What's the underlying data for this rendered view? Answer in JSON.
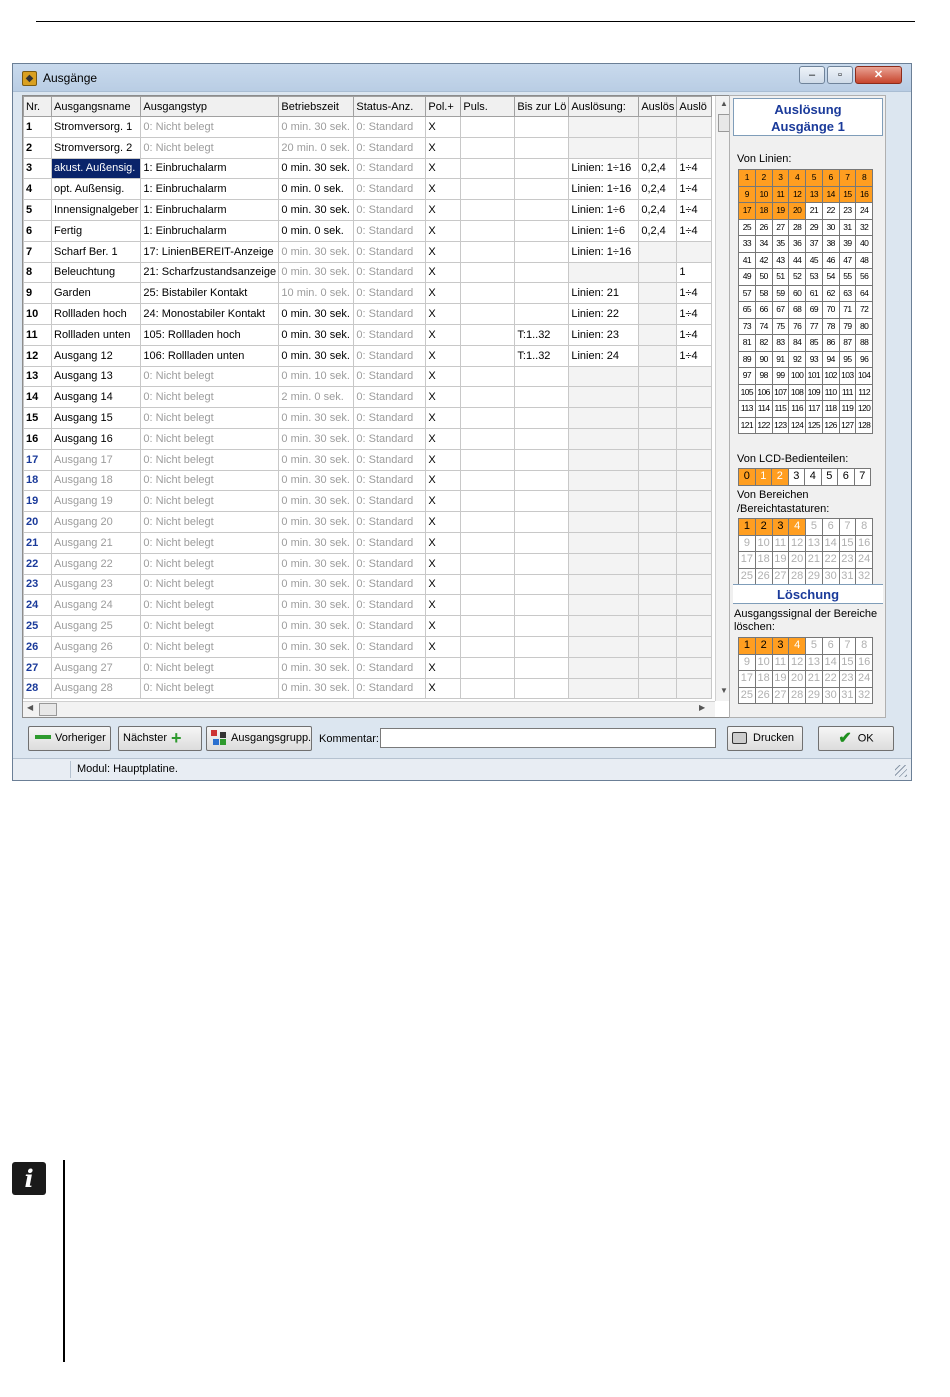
{
  "window": {
    "title": "Ausgänge"
  },
  "titlebar_buttons": {
    "minimize": "–",
    "maximize": "▫",
    "close": "✕"
  },
  "columns": [
    "Nr.",
    "Ausgangsname",
    "Ausgangstyp",
    "Betriebszeit",
    "Status-Anz.",
    "Pol.+",
    "Puls.",
    "Bis zur Lö",
    "Auslösung:",
    "Auslös",
    "Auslö"
  ],
  "rows": [
    {
      "nr": "1",
      "name": "Stromversorg. 1",
      "type": "0: Nicht belegt",
      "zeit": "0 min. 30 sek.",
      "status": "0: Standard",
      "pol": "X",
      "puls": "",
      "bis": "",
      "ausl": "",
      "ausl2": "",
      "ausl3": ""
    },
    {
      "nr": "2",
      "name": "Stromversorg. 2",
      "type": "0: Nicht belegt",
      "zeit": "20 min. 0 sek.",
      "status": "0: Standard",
      "pol": "X",
      "puls": "",
      "bis": "",
      "ausl": "",
      "ausl2": "",
      "ausl3": ""
    },
    {
      "nr": "3",
      "name": "akust. Außensig.",
      "type": "1: Einbruchalarm",
      "zeit": "0 min. 30 sek.",
      "status": "0: Standard",
      "pol": "X",
      "puls": "",
      "bis": "",
      "ausl": "Linien: 1÷16",
      "ausl2": "0,2,4",
      "ausl3": "1÷4"
    },
    {
      "nr": "4",
      "name": "opt. Außensig.",
      "type": "1: Einbruchalarm",
      "zeit": "0 min. 0 sek.",
      "status": "0: Standard",
      "pol": "X",
      "puls": "",
      "bis": "",
      "ausl": "Linien: 1÷16",
      "ausl2": "0,2,4",
      "ausl3": "1÷4"
    },
    {
      "nr": "5",
      "name": "Innensignalgeber",
      "type": "1: Einbruchalarm",
      "zeit": "0 min. 30 sek.",
      "status": "0: Standard",
      "pol": "X",
      "puls": "",
      "bis": "",
      "ausl": "Linien: 1÷6",
      "ausl2": "0,2,4",
      "ausl3": "1÷4"
    },
    {
      "nr": "6",
      "name": "Fertig",
      "type": "1: Einbruchalarm",
      "zeit": "0 min. 0 sek.",
      "status": "0: Standard",
      "pol": "X",
      "puls": "",
      "bis": "",
      "ausl": "Linien: 1÷6",
      "ausl2": "0,2,4",
      "ausl3": "1÷4"
    },
    {
      "nr": "7",
      "name": "Scharf Ber. 1",
      "type": "17: LinienBEREIT-Anzeige",
      "zeit": "0 min. 30 sek.",
      "status": "0: Standard",
      "pol": "X",
      "puls": "",
      "bis": "",
      "ausl": "Linien: 1÷16",
      "ausl2": "",
      "ausl3": ""
    },
    {
      "nr": "8",
      "name": "Beleuchtung",
      "type": "21: Scharfzustandsanzeige",
      "zeit": "0 min. 30 sek.",
      "status": "0: Standard",
      "pol": "X",
      "puls": "",
      "bis": "",
      "ausl": "",
      "ausl2": "",
      "ausl3": "1"
    },
    {
      "nr": "9",
      "name": "Garden",
      "type": "25: Bistabiler Kontakt",
      "zeit": "10 min. 0 sek.",
      "status": "0: Standard",
      "pol": "X",
      "puls": "",
      "bis": "",
      "ausl": "Linien: 21",
      "ausl2": "",
      "ausl3": "1÷4"
    },
    {
      "nr": "10",
      "name": "Rollladen hoch",
      "type": "24: Monostabiler Kontakt",
      "zeit": "0 min. 30 sek.",
      "status": "0: Standard",
      "pol": "X",
      "puls": "",
      "bis": "",
      "ausl": "Linien: 22",
      "ausl2": "",
      "ausl3": "1÷4"
    },
    {
      "nr": "11",
      "name": "Rollladen unten",
      "type": "105: Rollladen hoch",
      "zeit": "0 min. 30 sek.",
      "status": "0: Standard",
      "pol": "X",
      "puls": "",
      "bis": "T:1..32",
      "ausl": "Linien: 23",
      "ausl2": "",
      "ausl3": "1÷4"
    },
    {
      "nr": "12",
      "name": "Ausgang 12",
      "type": "106: Rollladen unten",
      "zeit": "0 min. 30 sek.",
      "status": "0: Standard",
      "pol": "X",
      "puls": "",
      "bis": "T:1..32",
      "ausl": "Linien: 24",
      "ausl2": "",
      "ausl3": "1÷4"
    },
    {
      "nr": "13",
      "name": "Ausgang 13",
      "type": "0: Nicht belegt",
      "zeit": "0 min. 10 sek.",
      "status": "0: Standard",
      "pol": "X",
      "puls": "",
      "bis": "",
      "ausl": "",
      "ausl2": "",
      "ausl3": ""
    },
    {
      "nr": "14",
      "name": "Ausgang 14",
      "type": "0: Nicht belegt",
      "zeit": "2 min. 0 sek.",
      "status": "0: Standard",
      "pol": "X",
      "puls": "",
      "bis": "",
      "ausl": "",
      "ausl2": "",
      "ausl3": ""
    },
    {
      "nr": "15",
      "name": "Ausgang 15",
      "type": "0: Nicht belegt",
      "zeit": "0 min. 30 sek.",
      "status": "0: Standard",
      "pol": "X",
      "puls": "",
      "bis": "",
      "ausl": "",
      "ausl2": "",
      "ausl3": ""
    },
    {
      "nr": "16",
      "name": "Ausgang 16",
      "type": "0: Nicht belegt",
      "zeit": "0 min. 30 sek.",
      "status": "0: Standard",
      "pol": "X",
      "puls": "",
      "bis": "",
      "ausl": "",
      "ausl2": "",
      "ausl3": ""
    },
    {
      "nr": "17",
      "name": "Ausgang 17",
      "type": "0: Nicht belegt",
      "zeit": "0 min. 30 sek.",
      "status": "0: Standard",
      "pol": "X",
      "puls": "",
      "bis": "",
      "ausl": "",
      "ausl2": "",
      "ausl3": ""
    },
    {
      "nr": "18",
      "name": "Ausgang 18",
      "type": "0: Nicht belegt",
      "zeit": "0 min. 30 sek.",
      "status": "0: Standard",
      "pol": "X",
      "puls": "",
      "bis": "",
      "ausl": "",
      "ausl2": "",
      "ausl3": ""
    },
    {
      "nr": "19",
      "name": "Ausgang 19",
      "type": "0: Nicht belegt",
      "zeit": "0 min. 30 sek.",
      "status": "0: Standard",
      "pol": "X",
      "puls": "",
      "bis": "",
      "ausl": "",
      "ausl2": "",
      "ausl3": ""
    },
    {
      "nr": "20",
      "name": "Ausgang 20",
      "type": "0: Nicht belegt",
      "zeit": "0 min. 30 sek.",
      "status": "0: Standard",
      "pol": "X",
      "puls": "",
      "bis": "",
      "ausl": "",
      "ausl2": "",
      "ausl3": ""
    },
    {
      "nr": "21",
      "name": "Ausgang 21",
      "type": "0: Nicht belegt",
      "zeit": "0 min. 30 sek.",
      "status": "0: Standard",
      "pol": "X",
      "puls": "",
      "bis": "",
      "ausl": "",
      "ausl2": "",
      "ausl3": ""
    },
    {
      "nr": "22",
      "name": "Ausgang 22",
      "type": "0: Nicht belegt",
      "zeit": "0 min. 30 sek.",
      "status": "0: Standard",
      "pol": "X",
      "puls": "",
      "bis": "",
      "ausl": "",
      "ausl2": "",
      "ausl3": ""
    },
    {
      "nr": "23",
      "name": "Ausgang 23",
      "type": "0: Nicht belegt",
      "zeit": "0 min. 30 sek.",
      "status": "0: Standard",
      "pol": "X",
      "puls": "",
      "bis": "",
      "ausl": "",
      "ausl2": "",
      "ausl3": ""
    },
    {
      "nr": "24",
      "name": "Ausgang 24",
      "type": "0: Nicht belegt",
      "zeit": "0 min. 30 sek.",
      "status": "0: Standard",
      "pol": "X",
      "puls": "",
      "bis": "",
      "ausl": "",
      "ausl2": "",
      "ausl3": ""
    },
    {
      "nr": "25",
      "name": "Ausgang 25",
      "type": "0: Nicht belegt",
      "zeit": "0 min. 30 sek.",
      "status": "0: Standard",
      "pol": "X",
      "puls": "",
      "bis": "",
      "ausl": "",
      "ausl2": "",
      "ausl3": ""
    },
    {
      "nr": "26",
      "name": "Ausgang 26",
      "type": "0: Nicht belegt",
      "zeit": "0 min. 30 sek.",
      "status": "0: Standard",
      "pol": "X",
      "puls": "",
      "bis": "",
      "ausl": "",
      "ausl2": "",
      "ausl3": ""
    },
    {
      "nr": "27",
      "name": "Ausgang 27",
      "type": "0: Nicht belegt",
      "zeit": "0 min. 30 sek.",
      "status": "0: Standard",
      "pol": "X",
      "puls": "",
      "bis": "",
      "ausl": "",
      "ausl2": "",
      "ausl3": ""
    },
    {
      "nr": "28",
      "name": "Ausgang 28",
      "type": "0: Nicht belegt",
      "zeit": "0 min. 30 sek.",
      "status": "0: Standard",
      "pol": "X",
      "puls": "",
      "bis": "",
      "ausl": "",
      "ausl2": "",
      "ausl3": ""
    }
  ],
  "right_panel": {
    "title": "Auslösung\nAusgänge 1",
    "von_linien_label": "Von Linien:",
    "linien_active": [
      1,
      2,
      3,
      4,
      5,
      6,
      7,
      8,
      9,
      10,
      11,
      12,
      13,
      14,
      15,
      16,
      17,
      18,
      19,
      20
    ],
    "lcd_label": "Von LCD-Bedienteilen:",
    "lcd_values": [
      "0",
      "1",
      "2",
      "3",
      "4",
      "5",
      "6",
      "7"
    ],
    "lcd_active": [
      0,
      1,
      2
    ],
    "bereiche_label": "Von Bereichen\n/Bereichtastaturen:",
    "bereiche_active": [
      1,
      2,
      3
    ],
    "bereiche_dim": [
      4
    ],
    "loeschung_title": "Löschung",
    "loeschung_label": "Ausgangssignal der Bereiche\nlöschen:",
    "loeschung_active": [
      1,
      2,
      3
    ],
    "loeschung_dim": [
      4
    ]
  },
  "toolbar": {
    "prev_label": "Vorheriger",
    "next_label": "Nächster",
    "group_label": "Ausgangsgrupp.",
    "comment_label": "Kommentar:",
    "comment_value": "",
    "print_label": "Drucken",
    "ok_label": "OK"
  },
  "statusbar": {
    "text": "Modul: Hauptplatine."
  },
  "colors": {
    "accent_orange": "#ff9e20",
    "title_blue": "#1a3a9a",
    "selection": "#0a246a"
  },
  "info_icon": "i"
}
